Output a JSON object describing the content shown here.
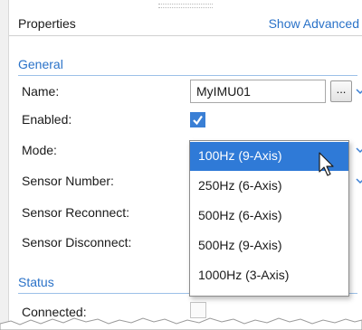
{
  "header": {
    "title": "Properties",
    "show_advanced": "Show Advanced"
  },
  "sections": {
    "general": "General",
    "status": "Status"
  },
  "fields": {
    "name": {
      "label": "Name:",
      "value": "MyIMU01",
      "browse": "..."
    },
    "enabled": {
      "label": "Enabled:",
      "checked": true
    },
    "mode": {
      "label": "Mode:",
      "value": "100Hz (9-Axis)"
    },
    "sensor_number": {
      "label": "Sensor Number:"
    },
    "sensor_reconnect": {
      "label": "Sensor Reconnect:"
    },
    "sensor_disconnect": {
      "label": "Sensor Disconnect:"
    },
    "connected": {
      "label": "Connected:",
      "checked": false
    }
  },
  "mode_options": [
    "100Hz (9-Axis)",
    "250Hz (6-Axis)",
    "500Hz (6-Axis)",
    "500Hz (9-Axis)",
    "1000Hz (3-Axis)"
  ],
  "colors": {
    "accent": "#2a72c8",
    "selection": "#2f7ad7",
    "check": "#3a7fd5"
  },
  "icons": {
    "browse": "ellipsis-icon",
    "expand": "chevron-down-icon",
    "cursor": "mouse-pointer-icon"
  }
}
